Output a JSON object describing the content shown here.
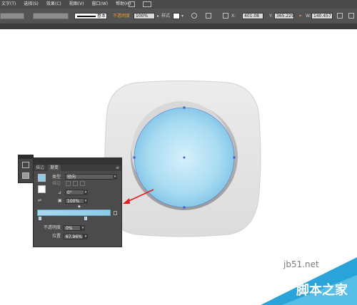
{
  "menubar": {
    "items": [
      {
        "label": "文字(T)"
      },
      {
        "label": "选择(S)"
      },
      {
        "label": "效果(C)"
      },
      {
        "label": "视图(V)"
      },
      {
        "label": "窗口(W)"
      },
      {
        "label": "帮助(H)"
      }
    ]
  },
  "options_bar": {
    "stroke_style": "基本",
    "opacity_label": "不透明度",
    "opacity_value": "100%",
    "style_label": "样式",
    "x_value": "401.08",
    "y_value": "365.229",
    "w_value": "140.457"
  },
  "gradient_panel": {
    "tab_stroke": "描边",
    "tab_gradient": "渐变",
    "type_label": "类型",
    "type_value": "径向",
    "stroke_label": "描边",
    "angle_value": "0°",
    "aspect_value": "100%",
    "opacity_label": "不透明度",
    "opacity_value": "0%",
    "location_label": "位置",
    "location_value": "67.96%"
  },
  "watermark": {
    "url": "jb51.net",
    "text": "脚本之家"
  },
  "colors": {
    "frame": "#e6e6e6",
    "ring": "#a9a9a9",
    "sphere_center": "#d2eefb",
    "sphere_edge": "#8ecdec",
    "arrow": "#e02020",
    "watermark_bg": "#2aa3d8"
  }
}
